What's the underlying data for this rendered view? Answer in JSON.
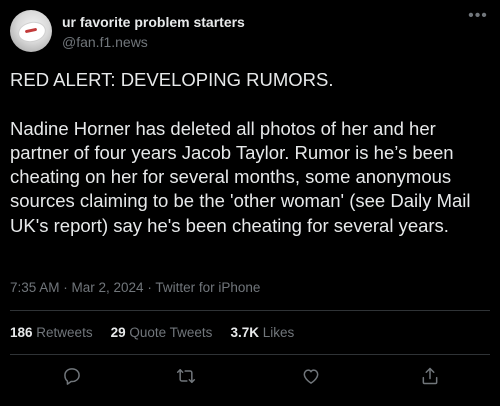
{
  "tweet": {
    "author": {
      "display_name": "ur favorite problem starters",
      "username": "@fan.f1.news"
    },
    "body": {
      "line1": "RED ALERT: DEVELOPING RUMORS.",
      "line2": "Nadine Horner has deleted all photos of her and her partner of four years Jacob Taylor. Rumor is he’s been cheating on her for several months, some anonymous sources claiming to be the 'other woman' (see Daily Mail UK's report) say he's been cheating for several years."
    },
    "meta": "7:35 AM · Mar 2, 2024 · Twitter for iPhone",
    "stats": {
      "retweets_count": "186",
      "retweets_label": "Retweets",
      "quotes_count": "29",
      "quotes_label": "Quote Tweets",
      "likes_count": "3.7K",
      "likes_label": "Likes"
    },
    "icons": {
      "more": "more-icon",
      "reply": "reply-icon",
      "retweet": "retweet-icon",
      "like": "like-icon",
      "share": "share-icon"
    }
  },
  "colors": {
    "background": "#000000",
    "text_primary": "#e7e9ea",
    "text_secondary": "#71767b",
    "divider": "#2f3336"
  }
}
